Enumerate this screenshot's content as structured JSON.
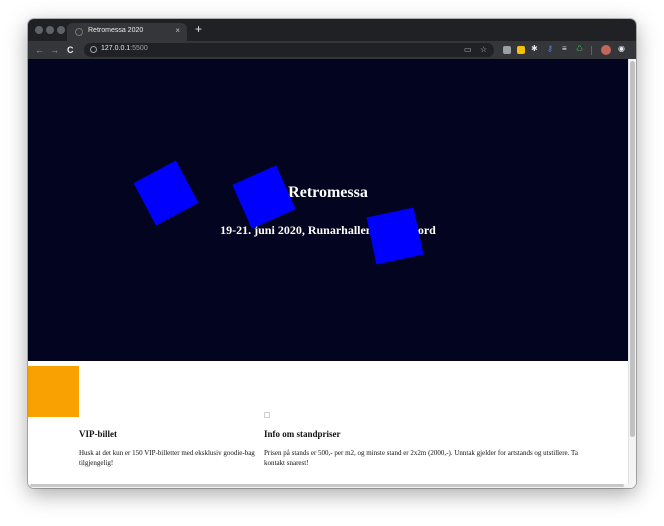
{
  "browser": {
    "tab_title": "Retromessa 2020",
    "tab_close": "×",
    "new_tab": "+",
    "nav": {
      "back": "←",
      "forward": "→",
      "reload": "C"
    },
    "url_host": "127.0.0.1",
    "url_port": ":5500",
    "omni_icons": {
      "cast": "▭",
      "bookmark": "☆"
    },
    "extensions": [
      {
        "icon": "shield-icon",
        "color": "#9aa0a6"
      },
      {
        "icon": "note-icon",
        "color": "#f4c20d"
      },
      {
        "icon": "gear-icon",
        "color": "#e8eaed"
      },
      {
        "icon": "key-icon",
        "color": "#4a8af4"
      },
      {
        "icon": "list-icon",
        "color": "#9aa0a6"
      },
      {
        "icon": "recycle-icon",
        "color": "#34a853"
      }
    ]
  },
  "hero": {
    "title": "Retromessa",
    "subtitle": "19-21. juni 2020, Runarhallen, Sandefjord",
    "background": "#030420",
    "square_color": "#0000ff"
  },
  "content": {
    "accent_color": "#f9a102",
    "cards": [
      {
        "title": "VIP-billet",
        "text": "Husk at det kun er 150 VIP-billetter med eksklusiv goodie-bag tilgjengelig!"
      },
      {
        "title": "Info om standpriser",
        "text": "Prisen på stands er 500,- per m2, og minste stand er 2x2m (2000,-). Unntak gjelder for artstands og utstillere. Ta kontakt snarest!"
      }
    ]
  }
}
